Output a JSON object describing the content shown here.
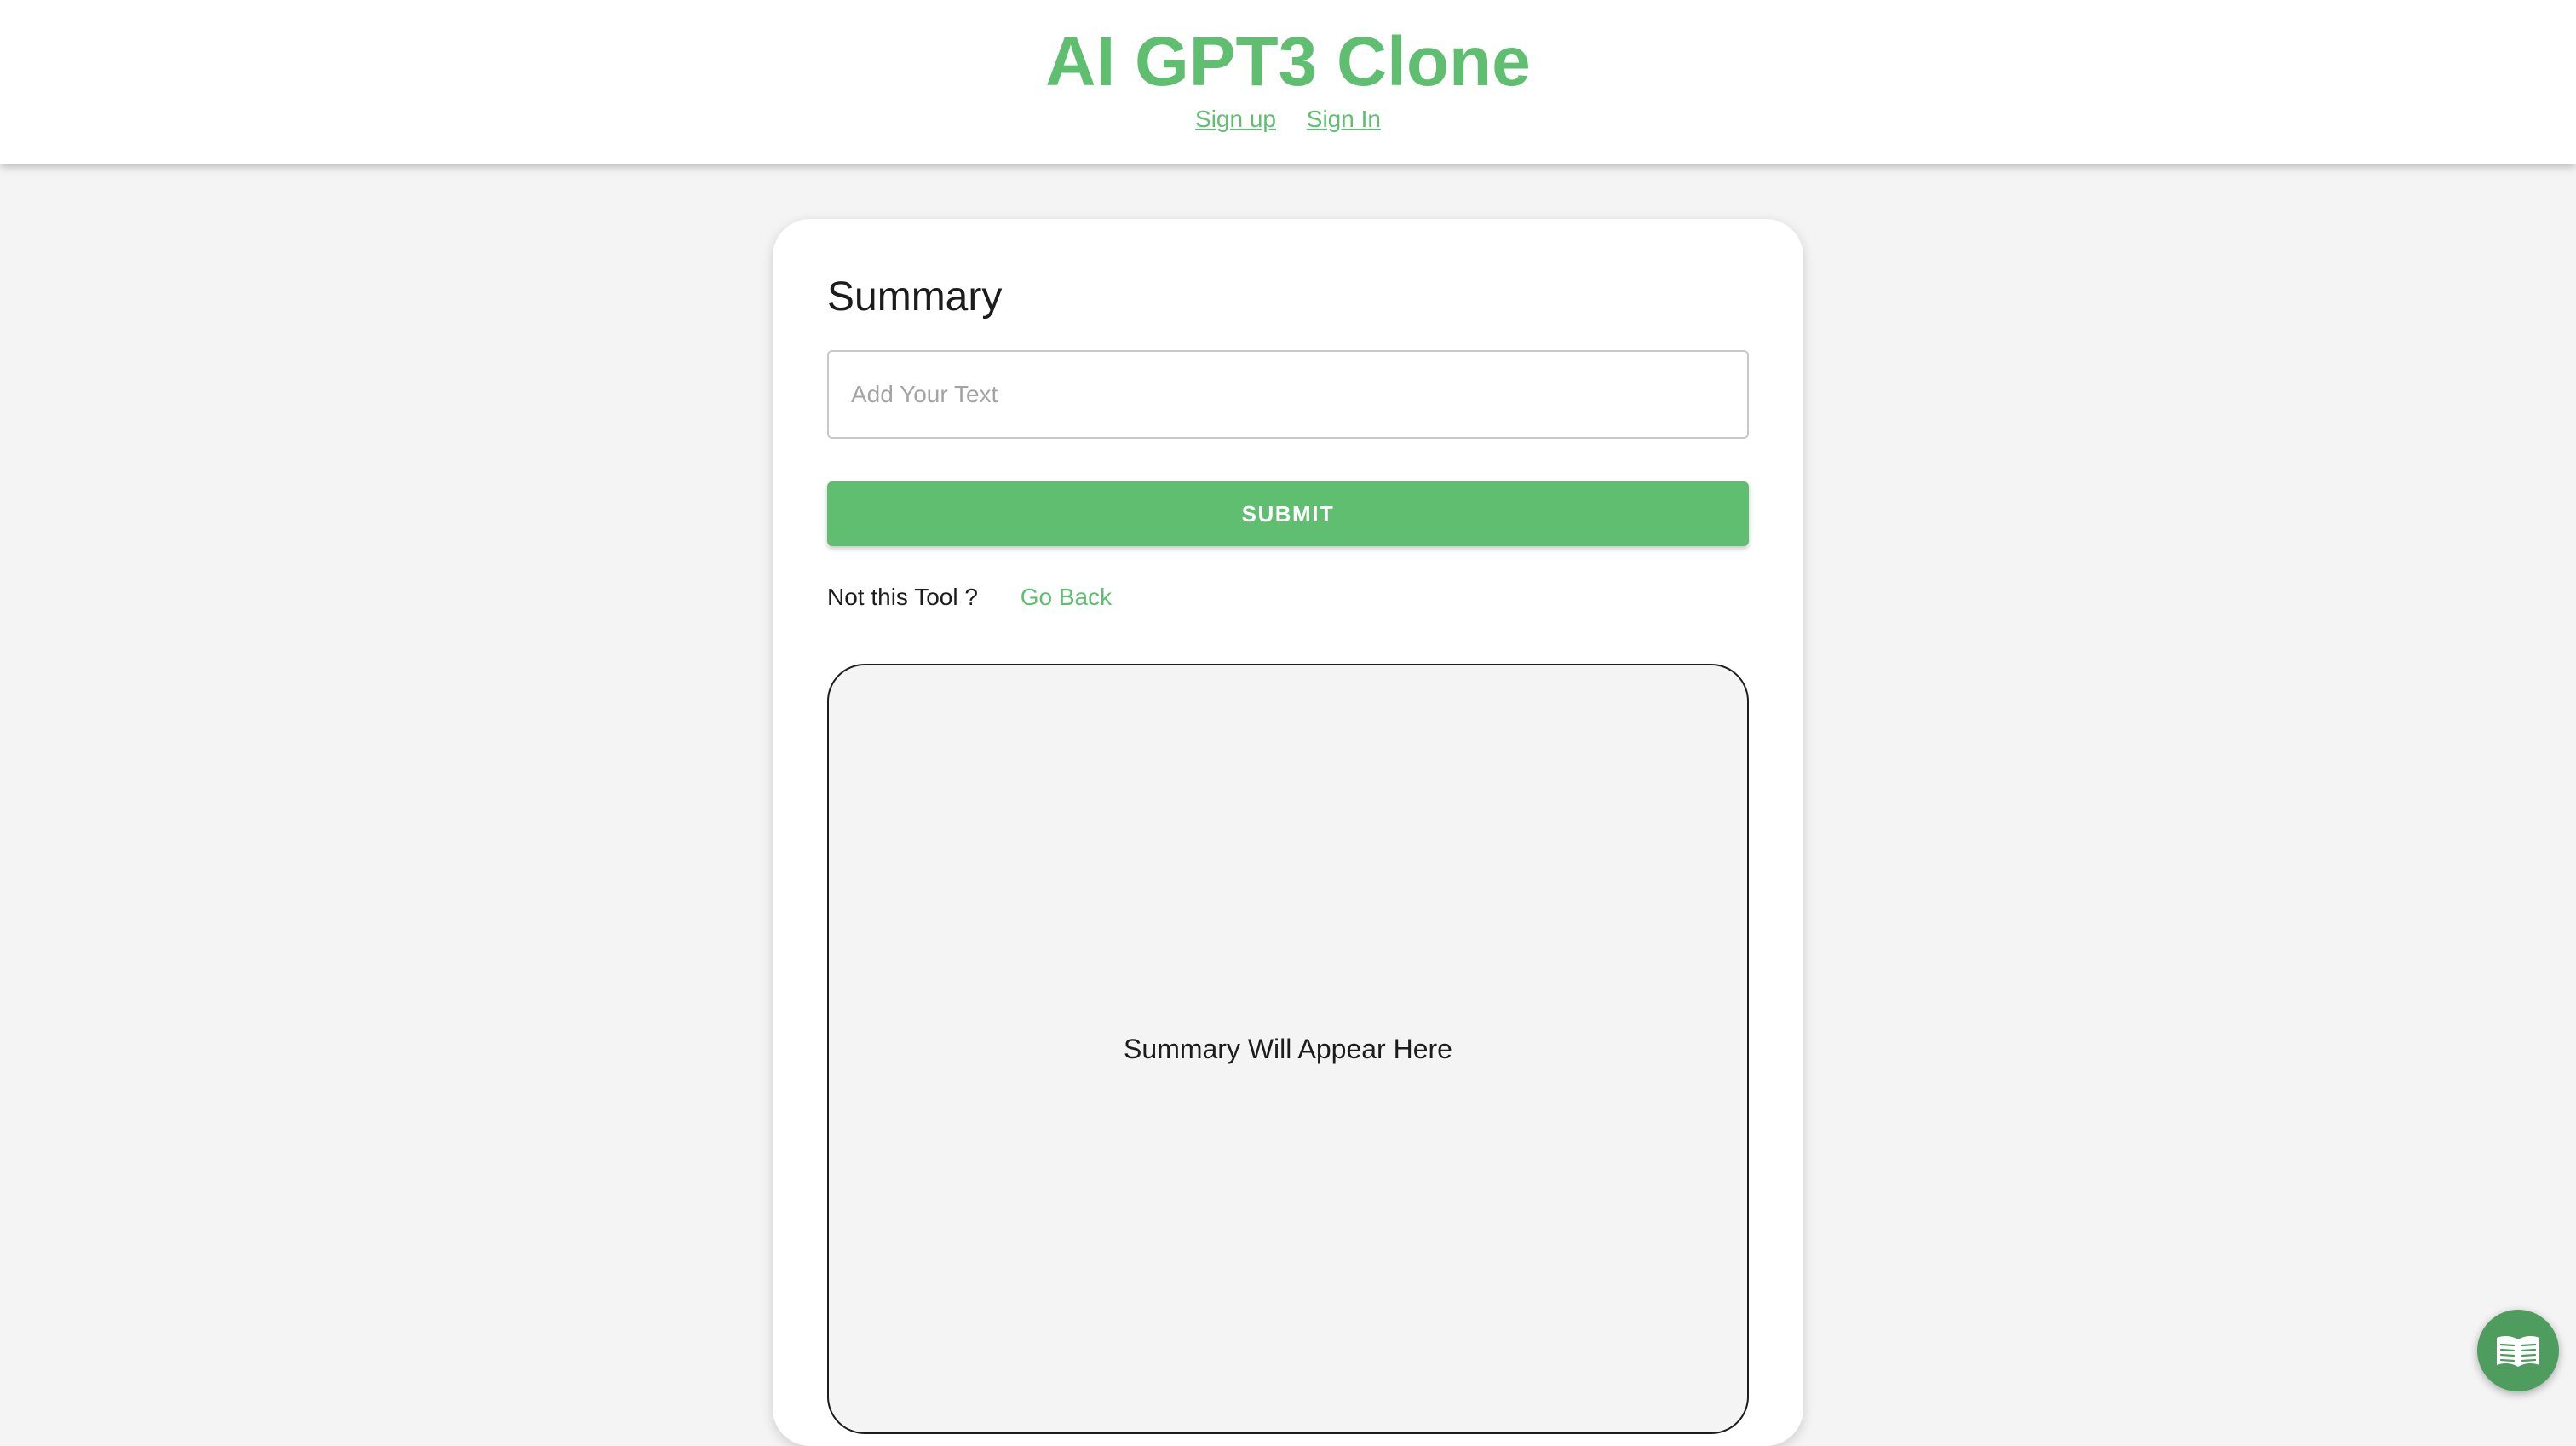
{
  "header": {
    "title": "AI GPT3 Clone",
    "links": [
      {
        "label": "Sign up"
      },
      {
        "label": "Sign In"
      }
    ]
  },
  "tool": {
    "title": "Summary",
    "input": {
      "placeholder": "Add Your Text",
      "value": ""
    },
    "submit_label": "SUBMIT",
    "not_this_tool": "Not this Tool ?",
    "go_back_label": "Go Back",
    "output_placeholder": "Summary Will Appear Here"
  },
  "fab": {
    "icon": "book-open-icon"
  },
  "colors": {
    "accent": "#5fbe70",
    "fab": "#4f9d5e",
    "background": "#f4f4f4"
  }
}
